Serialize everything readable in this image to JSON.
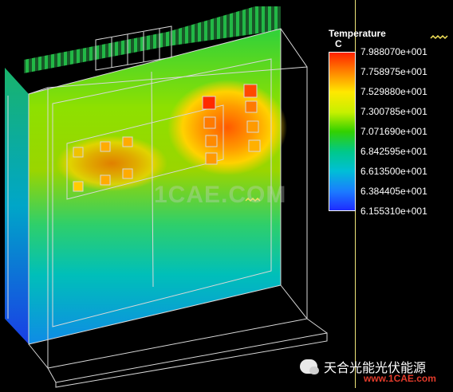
{
  "legend": {
    "title": "Temperature",
    "unit": "C",
    "values": [
      "7.988070e+001",
      "7.758975e+001",
      "7.529880e+001",
      "7.300785e+001",
      "7.071690e+001",
      "6.842595e+001",
      "6.613500e+001",
      "6.384405e+001",
      "6.155310e+001"
    ],
    "colors": [
      "#ff2200",
      "#ff8a00",
      "#ffe800",
      "#c6f000",
      "#33d100",
      "#00c88c",
      "#00bfd6",
      "#1b7cff",
      "#1f2cff"
    ]
  },
  "watermark_center": "1CAE.COM",
  "wechat_credit": "天合光能光伏能源",
  "corner_logo": "www.1CAE.com"
}
